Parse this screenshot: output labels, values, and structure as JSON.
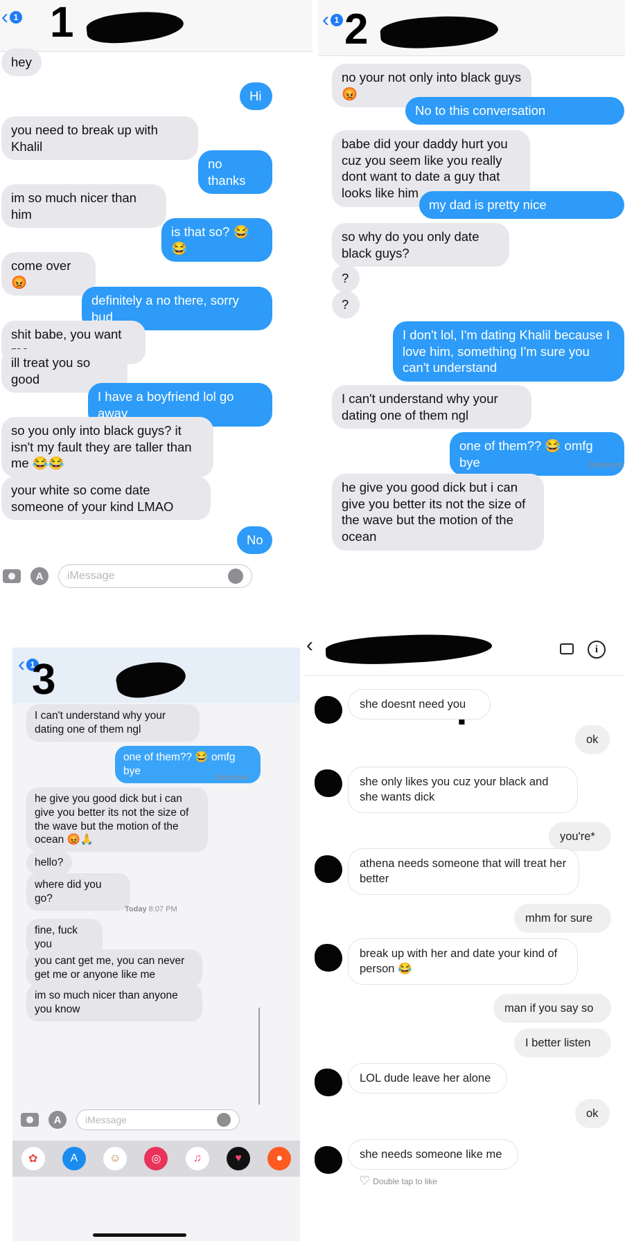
{
  "panel1": {
    "number": "1",
    "unread": "1",
    "messages": [
      {
        "dir": "in",
        "text": "hey"
      },
      {
        "dir": "out",
        "text": "Hi"
      },
      {
        "dir": "in",
        "text": "you need to break up with Khalil"
      },
      {
        "dir": "out",
        "text": "no thanks"
      },
      {
        "dir": "in",
        "text": "im so much nicer than him"
      },
      {
        "dir": "out",
        "text": "is that so? 😂😂"
      },
      {
        "dir": "in",
        "text": "come over 😡"
      },
      {
        "dir": "out",
        "text": "definitely a no there, sorry bud"
      },
      {
        "dir": "in",
        "text": "shit babe, you want me"
      },
      {
        "dir": "in",
        "text": "ill treat you so good"
      },
      {
        "dir": "out",
        "text": "I have a boyfriend lol go away"
      },
      {
        "dir": "in",
        "text": "so you only into black guys? it isn't my fault they are taller than me 😂😂"
      },
      {
        "dir": "in",
        "text": "your white so come date someone of your kind LMAO"
      },
      {
        "dir": "out",
        "text": "No"
      }
    ],
    "composer_placeholder": "iMessage"
  },
  "panel2": {
    "number": "2",
    "unread": "1",
    "messages": [
      {
        "dir": "in",
        "text": "no your not only into black guys 😡"
      },
      {
        "dir": "out",
        "text": "No to this conversation"
      },
      {
        "dir": "in",
        "text": "babe did your daddy hurt you cuz you seem like you really dont want to date a guy that looks like him"
      },
      {
        "dir": "out",
        "text": "my dad is pretty nice"
      },
      {
        "dir": "in",
        "text": "so why do you only date black guys?"
      },
      {
        "dir": "in",
        "text": "?"
      },
      {
        "dir": "in",
        "text": "?"
      },
      {
        "dir": "out",
        "text": "I don't lol, I'm dating Khalil because I love him, something I'm sure you can't understand"
      },
      {
        "dir": "in",
        "text": "I can't understand why your dating one of them ngl"
      },
      {
        "dir": "out",
        "text": "one of them?? 😂 omfg bye"
      },
      {
        "dir": "in",
        "text": "he give you good dick but i can give you better its not the size of the wave but the motion of the ocean"
      }
    ],
    "delivered": "Delivered"
  },
  "panel3": {
    "number": "3",
    "unread": "1",
    "messages": [
      {
        "dir": "in",
        "text": "I can't understand why your dating one of them ngl"
      },
      {
        "dir": "out",
        "text": "one of them?? 😂 omfg bye"
      },
      {
        "dir": "in",
        "text": "he give you good dick but i can give you better its not the size of the wave but the motion of the ocean 😡🙏"
      },
      {
        "dir": "in",
        "text": "hello?"
      },
      {
        "dir": "in",
        "text": "where did you go?"
      },
      {
        "dir": "in",
        "text": "fine, fuck you"
      },
      {
        "dir": "in",
        "text": "you cant get me, you can never get me or anyone like me"
      },
      {
        "dir": "in",
        "text": "im so much nicer than anyone you know"
      }
    ],
    "delivered": "Delivered",
    "timestamp_day": "Today",
    "timestamp_time": "8:07 PM",
    "composer_placeholder": "iMessage"
  },
  "panel4": {
    "number": "4",
    "messages": [
      {
        "dir": "in",
        "text": "she doesnt need you"
      },
      {
        "dir": "out",
        "text": "ok"
      },
      {
        "dir": "in",
        "text": "she only likes you cuz your black and she wants dick"
      },
      {
        "dir": "out",
        "text": "you're*"
      },
      {
        "dir": "in",
        "text": "athena needs someone that will treat her better"
      },
      {
        "dir": "out",
        "text": "mhm for sure"
      },
      {
        "dir": "in",
        "text": "break up with her and date your kind of person 😂"
      },
      {
        "dir": "out",
        "text": "man if you say so"
      },
      {
        "dir": "out",
        "text": "I better listen"
      },
      {
        "dir": "in",
        "text": "LOL dude leave her alone"
      },
      {
        "dir": "out",
        "text": "ok"
      },
      {
        "dir": "in",
        "text": "she needs someone like me"
      }
    ],
    "double_tap_hint": "Double tap to like"
  },
  "colors": {
    "imessage_blue": "#2d9bf7",
    "incoming_gray": "#e8e8ec",
    "ios_link_blue": "#1e7cf5"
  },
  "icons": [
    "chevron-left-icon",
    "camera-icon",
    "app-store-icon",
    "microphone-icon",
    "video-call-icon",
    "info-icon",
    "heart-icon"
  ]
}
